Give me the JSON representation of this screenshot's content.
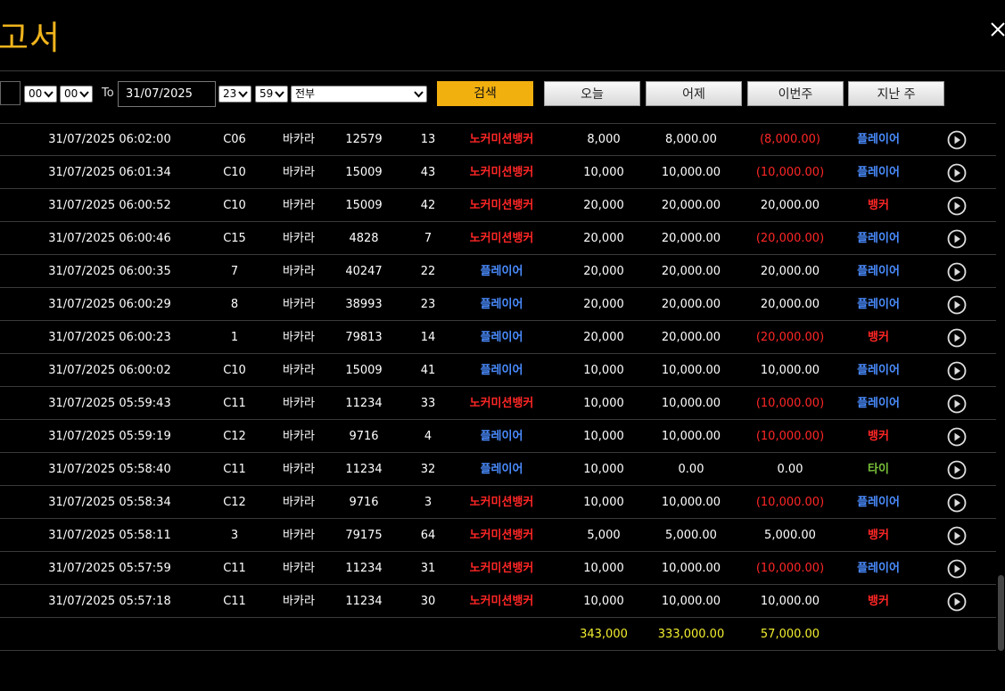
{
  "header": {
    "title": "고서"
  },
  "filter": {
    "from_hour": "00",
    "from_minute": "00",
    "to_label": "To",
    "to_date": "31/07/2025",
    "to_hour": "23",
    "to_minute": "59",
    "game_filter": "전부",
    "search_label": "검색",
    "today_label": "오늘",
    "yesterday_label": "어제",
    "this_week_label": "이번주",
    "last_week_label": "지난 주"
  },
  "colors": {
    "accent": "#f0b41c",
    "banker": "#ff2626",
    "player": "#4a8cff",
    "tie": "#79c23a",
    "total": "#f3ee2f"
  },
  "rows": [
    {
      "time": "31/07/2025 06:02:00",
      "table": "C06",
      "game": "바카라",
      "round": "12579",
      "shoe": "13",
      "bet": "노커미션뱅커",
      "bet_type": "banker",
      "amount": "8,000",
      "valid": "8,000.00",
      "winloss": "(8,000.00)",
      "neg": true,
      "result": "플레이어",
      "result_type": "player"
    },
    {
      "time": "31/07/2025 06:01:34",
      "table": "C10",
      "game": "바카라",
      "round": "15009",
      "shoe": "43",
      "bet": "노커미션뱅커",
      "bet_type": "banker",
      "amount": "10,000",
      "valid": "10,000.00",
      "winloss": "(10,000.00)",
      "neg": true,
      "result": "플레이어",
      "result_type": "player"
    },
    {
      "time": "31/07/2025 06:00:52",
      "table": "C10",
      "game": "바카라",
      "round": "15009",
      "shoe": "42",
      "bet": "노커미션뱅커",
      "bet_type": "banker",
      "amount": "20,000",
      "valid": "20,000.00",
      "winloss": "20,000.00",
      "neg": false,
      "result": "뱅커",
      "result_type": "banker"
    },
    {
      "time": "31/07/2025 06:00:46",
      "table": "C15",
      "game": "바카라",
      "round": "4828",
      "shoe": "7",
      "bet": "노커미션뱅커",
      "bet_type": "banker",
      "amount": "20,000",
      "valid": "20,000.00",
      "winloss": "(20,000.00)",
      "neg": true,
      "result": "플레이어",
      "result_type": "player"
    },
    {
      "time": "31/07/2025 06:00:35",
      "table": "7",
      "game": "바카라",
      "round": "40247",
      "shoe": "22",
      "bet": "플레이어",
      "bet_type": "player",
      "amount": "20,000",
      "valid": "20,000.00",
      "winloss": "20,000.00",
      "neg": false,
      "result": "플레이어",
      "result_type": "player"
    },
    {
      "time": "31/07/2025 06:00:29",
      "table": "8",
      "game": "바카라",
      "round": "38993",
      "shoe": "23",
      "bet": "플레이어",
      "bet_type": "player",
      "amount": "20,000",
      "valid": "20,000.00",
      "winloss": "20,000.00",
      "neg": false,
      "result": "플레이어",
      "result_type": "player"
    },
    {
      "time": "31/07/2025 06:00:23",
      "table": "1",
      "game": "바카라",
      "round": "79813",
      "shoe": "14",
      "bet": "플레이어",
      "bet_type": "player",
      "amount": "20,000",
      "valid": "20,000.00",
      "winloss": "(20,000.00)",
      "neg": true,
      "result": "뱅커",
      "result_type": "banker"
    },
    {
      "time": "31/07/2025 06:00:02",
      "table": "C10",
      "game": "바카라",
      "round": "15009",
      "shoe": "41",
      "bet": "플레이어",
      "bet_type": "player",
      "amount": "10,000",
      "valid": "10,000.00",
      "winloss": "10,000.00",
      "neg": false,
      "result": "플레이어",
      "result_type": "player"
    },
    {
      "time": "31/07/2025 05:59:43",
      "table": "C11",
      "game": "바카라",
      "round": "11234",
      "shoe": "33",
      "bet": "노커미션뱅커",
      "bet_type": "banker",
      "amount": "10,000",
      "valid": "10,000.00",
      "winloss": "(10,000.00)",
      "neg": true,
      "result": "플레이어",
      "result_type": "player"
    },
    {
      "time": "31/07/2025 05:59:19",
      "table": "C12",
      "game": "바카라",
      "round": "9716",
      "shoe": "4",
      "bet": "플레이어",
      "bet_type": "player",
      "amount": "10,000",
      "valid": "10,000.00",
      "winloss": "(10,000.00)",
      "neg": true,
      "result": "뱅커",
      "result_type": "banker"
    },
    {
      "time": "31/07/2025 05:58:40",
      "table": "C11",
      "game": "바카라",
      "round": "11234",
      "shoe": "32",
      "bet": "플레이어",
      "bet_type": "player",
      "amount": "10,000",
      "valid": "0.00",
      "winloss": "0.00",
      "neg": false,
      "result": "타이",
      "result_type": "tie"
    },
    {
      "time": "31/07/2025 05:58:34",
      "table": "C12",
      "game": "바카라",
      "round": "9716",
      "shoe": "3",
      "bet": "노커미션뱅커",
      "bet_type": "banker",
      "amount": "10,000",
      "valid": "10,000.00",
      "winloss": "(10,000.00)",
      "neg": true,
      "result": "플레이어",
      "result_type": "player"
    },
    {
      "time": "31/07/2025 05:58:11",
      "table": "3",
      "game": "바카라",
      "round": "79175",
      "shoe": "64",
      "bet": "노커미션뱅커",
      "bet_type": "banker",
      "amount": "5,000",
      "valid": "5,000.00",
      "winloss": "5,000.00",
      "neg": false,
      "result": "뱅커",
      "result_type": "banker"
    },
    {
      "time": "31/07/2025 05:57:59",
      "table": "C11",
      "game": "바카라",
      "round": "11234",
      "shoe": "31",
      "bet": "노커미션뱅커",
      "bet_type": "banker",
      "amount": "10,000",
      "valid": "10,000.00",
      "winloss": "(10,000.00)",
      "neg": true,
      "result": "플레이어",
      "result_type": "player"
    },
    {
      "time": "31/07/2025 05:57:18",
      "table": "C11",
      "game": "바카라",
      "round": "11234",
      "shoe": "30",
      "bet": "노커미션뱅커",
      "bet_type": "banker",
      "amount": "10,000",
      "valid": "10,000.00",
      "winloss": "10,000.00",
      "neg": false,
      "result": "뱅커",
      "result_type": "banker"
    }
  ],
  "totals": {
    "amount": "343,000",
    "valid": "333,000.00",
    "winloss": "57,000.00"
  }
}
